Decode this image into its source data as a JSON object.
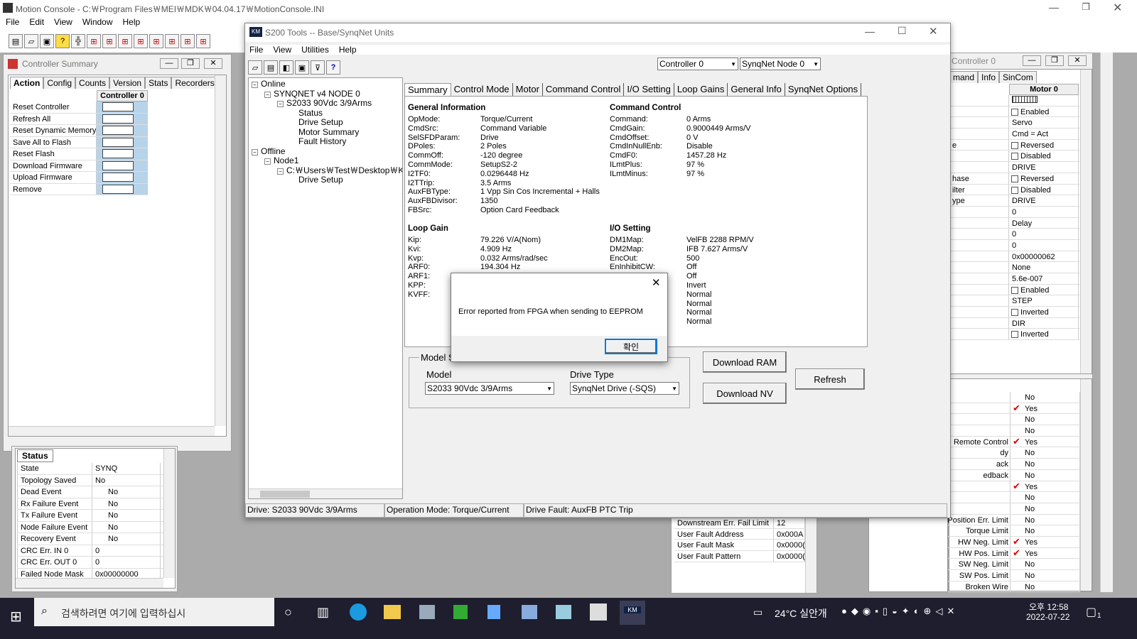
{
  "main": {
    "title": "Motion Console - C:￦Program Files￦MEI￦MDK￦04.04.17￦MotionConsole.INI",
    "menu": [
      "File",
      "Edit",
      "View",
      "Window",
      "Help"
    ]
  },
  "summary": {
    "title": "Controller Summary",
    "tabs": [
      "Action",
      "Config",
      "Counts",
      "Version",
      "Stats",
      "Recorders"
    ],
    "col_header": "Controller 0",
    "actions": [
      "Reset Controller",
      "Refresh All",
      "Reset Dynamic Memory",
      "Save All to Flash",
      "Reset Flash",
      "Download Firmware",
      "Upload Firmware",
      "Remove"
    ]
  },
  "status": {
    "header": "Status",
    "rows": [
      [
        "State",
        "SYNQ"
      ],
      [
        "Topology Saved",
        "No"
      ],
      [
        "Dead Event",
        "No"
      ],
      [
        "Rx Failure Event",
        "No"
      ],
      [
        "Tx Failure Event",
        "No"
      ],
      [
        "Node Failure Event",
        "No"
      ],
      [
        "Recovery Event",
        "No"
      ],
      [
        "CRC Err. IN 0",
        "0"
      ],
      [
        "CRC Err. OUT 0",
        "0"
      ],
      [
        "Failed Node Mask",
        "0x00000000"
      ]
    ]
  },
  "right": {
    "title": "Controller 0",
    "tabs": [
      "mand",
      "Info",
      "SinCom"
    ],
    "header": "Motor 0",
    "rows": [
      [
        "",
        ""
      ],
      [
        "",
        "Enabled"
      ],
      [
        "",
        "Servo"
      ],
      [
        "",
        "Cmd = Act"
      ],
      [
        "e",
        "Reversed"
      ],
      [
        "",
        "Disabled"
      ],
      [
        "",
        "DRIVE"
      ],
      [
        "hase",
        "Reversed"
      ],
      [
        "ilter",
        "Disabled"
      ],
      [
        "ype",
        "DRIVE"
      ],
      [
        "",
        "0"
      ],
      [
        "",
        "Delay"
      ],
      [
        "",
        "0"
      ],
      [
        "",
        "0"
      ],
      [
        "",
        "0x00000062"
      ],
      [
        "",
        "None"
      ],
      [
        "",
        "5.6e-007"
      ],
      [
        "",
        "Enabled"
      ],
      [
        "",
        "STEP"
      ],
      [
        "",
        "Inverted"
      ],
      [
        "",
        "DIR"
      ],
      [
        "",
        "Inverted"
      ]
    ],
    "lower": [
      [
        "",
        "No"
      ],
      [
        "",
        "Yes"
      ],
      [
        "",
        "No"
      ],
      [
        "",
        "No"
      ],
      [
        "Remote Control",
        "Yes"
      ],
      [
        "dy",
        "No"
      ],
      [
        "ack",
        "No"
      ],
      [
        "edback",
        "No"
      ],
      [
        "",
        "Yes"
      ],
      [
        "",
        "No"
      ],
      [
        "",
        "No"
      ],
      [
        "Position Err. Limit",
        "No"
      ],
      [
        "Torque Limit",
        "No"
      ],
      [
        "HW Neg. Limit",
        "Yes"
      ],
      [
        "HW Pos. Limit",
        "Yes"
      ],
      [
        "SW Neg. Limit",
        "No"
      ],
      [
        "SW Pos. Limit",
        "No"
      ],
      [
        "Broken Wire",
        "No"
      ]
    ]
  },
  "midbottom": [
    [
      "Downstream Err. Fail Limit",
      "12"
    ],
    [
      "User Fault Address",
      "0x000A"
    ],
    [
      "User Fault Mask",
      "0x0000("
    ],
    [
      "User Fault Pattern",
      "0x0000("
    ]
  ],
  "s200": {
    "title": "S200 Tools -- Base/SynqNet Units",
    "menu": [
      "File",
      "View",
      "Utilities",
      "Help"
    ],
    "controller": "Controller 0",
    "node": "SynqNet Node 0",
    "tree": [
      {
        "t": "Online",
        "d": 0
      },
      {
        "t": "SYNQNET v4 NODE 0",
        "d": 1
      },
      {
        "t": "S2033 90Vdc  3/9Arms",
        "d": 2
      },
      {
        "t": "Status",
        "d": 3
      },
      {
        "t": "Drive Setup",
        "d": 3
      },
      {
        "t": "Motor Summary",
        "d": 3
      },
      {
        "t": "Fault History",
        "d": 3
      },
      {
        "t": "Offline",
        "d": 0
      },
      {
        "t": "Node1",
        "d": 1
      },
      {
        "t": "C:￦Users￦Test￦Desktop￦K",
        "d": 2
      },
      {
        "t": "Drive Setup",
        "d": 3
      }
    ],
    "tabs": [
      "Summary",
      "Control Mode",
      "Motor",
      "Command Control",
      "I/O Setting",
      "Loop Gains",
      "General Info",
      "SynqNet Options"
    ],
    "gi_title": "General Information",
    "gi": [
      [
        "OpMode:",
        "Torque/Current"
      ],
      [
        "CmdSrc:",
        "Command Variable"
      ],
      [
        "SelSFDParam:",
        "Drive"
      ],
      [
        "DPoles:",
        "2 Poles"
      ],
      [
        "CommOff:",
        "-120 degree"
      ],
      [
        "CommMode:",
        "SetupS2-2"
      ],
      [
        "I2TF0:",
        "0.0296448 Hz"
      ],
      [
        "I2TTrip:",
        "3.5 Arms"
      ],
      [
        "AuxFBType:",
        "1 Vpp Sin Cos Incremental + Halls"
      ],
      [
        "AuxFBDivisor:",
        "1350"
      ],
      [
        "FBSrc:",
        "Option Card Feedback"
      ]
    ],
    "cc_title": "Command Control",
    "cc": [
      [
        "Command:",
        "0 Arms"
      ],
      [
        "CmdGain:",
        "0.9000449 Arms/V"
      ],
      [
        "CmdOffset:",
        "0 V"
      ],
      [
        "CmdInNullEnb:",
        "Disable"
      ],
      [
        "CmdF0:",
        "1457.28 Hz"
      ],
      [
        "ILmtPlus:",
        "97 %"
      ],
      [
        "ILmtMinus:",
        "97 %"
      ]
    ],
    "lg_title": "Loop Gain",
    "lg": [
      [
        "Kip:",
        "79.226 V/A(Nom)"
      ],
      [
        "Kvi:",
        "4.909 Hz"
      ],
      [
        "Kvp:",
        "0.032 Arms/rad/sec"
      ],
      [
        "ARF0:",
        "194.304 Hz"
      ],
      [
        "ARF1:",
        ""
      ],
      [
        "KPP:",
        ""
      ],
      [
        "KVFF:",
        ""
      ]
    ],
    "io_title": "I/O Setting",
    "io": [
      [
        "DM1Map:",
        "VelFB 2288 RPM/V"
      ],
      [
        "DM2Map:",
        "IFB 7.627 Arms/V"
      ],
      [
        "EncOut:",
        "500"
      ],
      [
        "EnInhibitCW:",
        "Off"
      ],
      [
        "",
        "Off"
      ],
      [
        "",
        "Invert"
      ],
      [
        "",
        "Normal"
      ],
      [
        "",
        "Normal"
      ],
      [
        "",
        "Normal"
      ],
      [
        "",
        "Normal"
      ]
    ],
    "model_group": "Model S",
    "model_label": "Model",
    "model_value": "S2033 90Vdc  3/9Arms",
    "type_label": "Drive Type",
    "type_value": "SynqNet Drive (-SQS)",
    "download_ram": "Download RAM",
    "download_nv": "Download NV",
    "refresh": "Refresh",
    "status": [
      "Drive: S2033 90Vdc  3/9Arms",
      "Operation Mode: Torque/Current",
      "Drive Fault: AuxFB PTC Trip"
    ]
  },
  "dialog": {
    "message": "Error reported from FPGA when sending to EEPROM",
    "ok": "확인"
  },
  "taskbar": {
    "search": "검색하려면 여기에 입력하십시",
    "weather": "24°C  실안개",
    "time": "오후 12:58",
    "date": "2022-07-22",
    "badge": "1"
  }
}
